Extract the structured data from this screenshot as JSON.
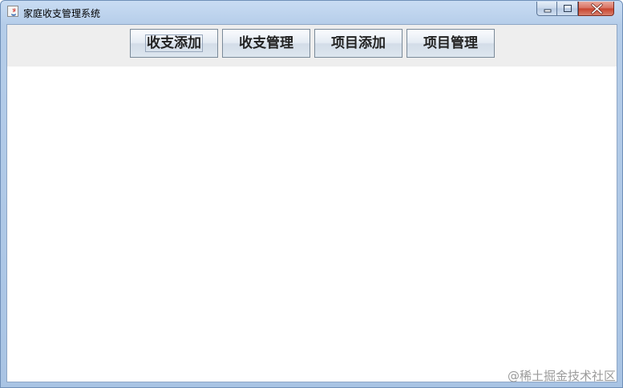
{
  "window": {
    "title": "家庭收支管理系统"
  },
  "toolbar": {
    "buttons": [
      {
        "label": "收支添加"
      },
      {
        "label": "收支管理"
      },
      {
        "label": "项目添加"
      },
      {
        "label": "项目管理"
      }
    ]
  },
  "icons": {
    "app": "java-app-icon",
    "minimize": "minimize-icon",
    "maximize": "maximize-icon",
    "close": "close-icon"
  },
  "watermark": {
    "text": "@稀土掘金技术社区"
  }
}
